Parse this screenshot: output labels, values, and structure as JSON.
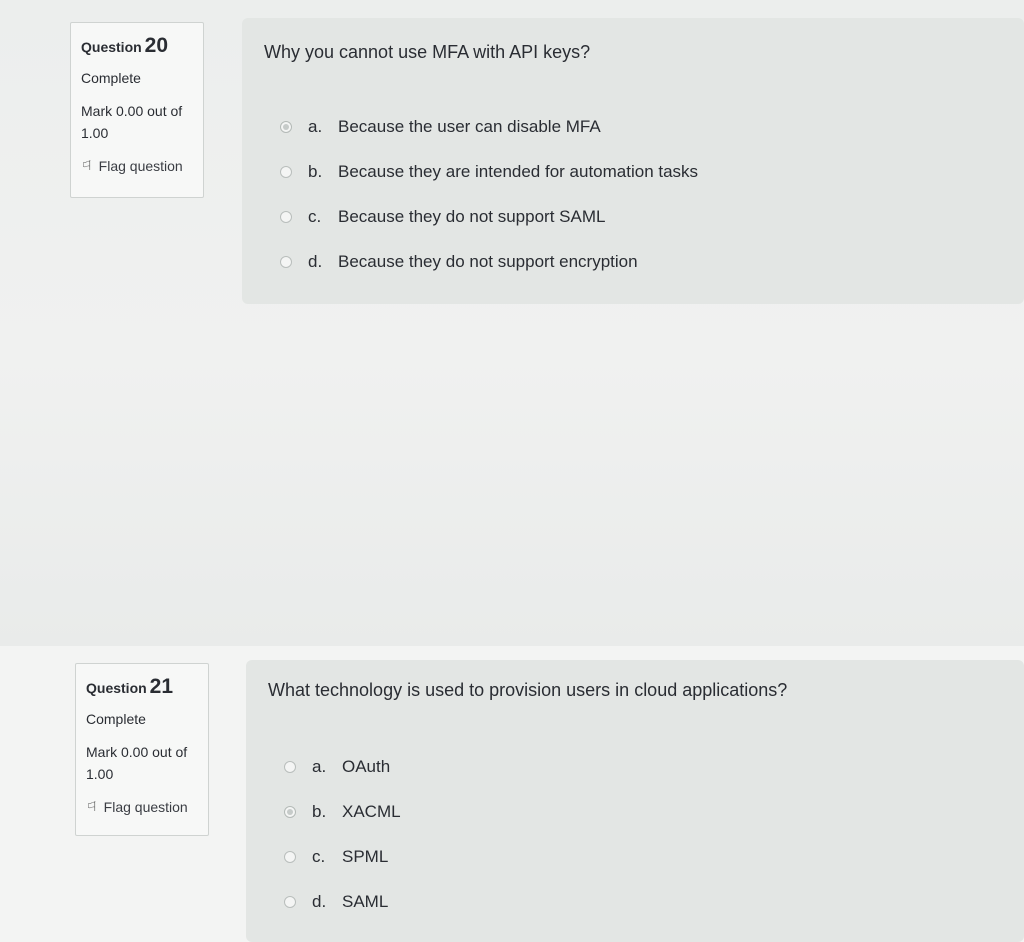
{
  "questions": [
    {
      "label": "Question",
      "number": "20",
      "state": "Complete",
      "mark": "Mark 0.00 out of 1.00",
      "flag_label": "Flag question",
      "text": "Why you cannot use MFA with API keys?",
      "answers": [
        {
          "letter": "a.",
          "text": "Because the user can disable MFA",
          "selected": true
        },
        {
          "letter": "b.",
          "text": "Because they are intended for automation tasks",
          "selected": false
        },
        {
          "letter": "c.",
          "text": "Because they do not support SAML",
          "selected": false
        },
        {
          "letter": "d.",
          "text": "Because they do not support encryption",
          "selected": false
        }
      ]
    },
    {
      "label": "Question",
      "number": "21",
      "state": "Complete",
      "mark": "Mark 0.00 out of 1.00",
      "flag_label": "Flag question",
      "text": "What technology is used to provision users in cloud applications?",
      "answers": [
        {
          "letter": "a.",
          "text": "OAuth",
          "selected": false
        },
        {
          "letter": "b.",
          "text": "XACML",
          "selected": true
        },
        {
          "letter": "c.",
          "text": "SPML",
          "selected": false
        },
        {
          "letter": "d.",
          "text": "SAML",
          "selected": false
        }
      ]
    }
  ],
  "icons": {
    "flag": "flag-icon",
    "radio": "radio-button"
  }
}
